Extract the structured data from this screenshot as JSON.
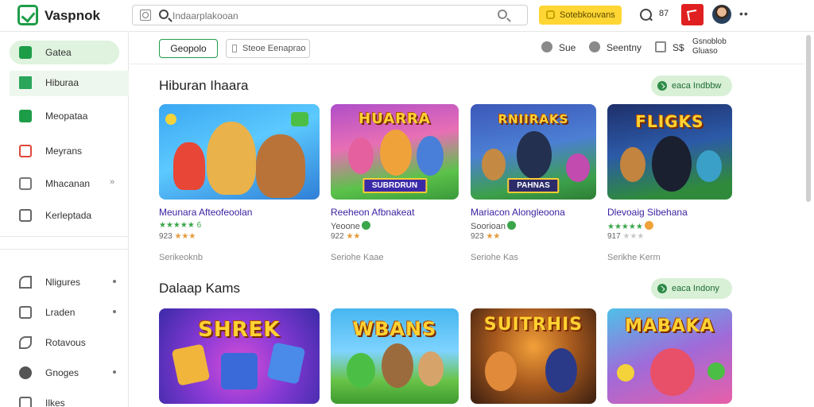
{
  "header": {
    "brand": "Vaspnok",
    "search_placeholder": "Indaarplakooan",
    "subscribe_label": "Sotebkouvans",
    "notif_count": "87",
    "more": "••"
  },
  "sidebar": {
    "items": [
      {
        "label": "Gatea",
        "icon": "game-icon"
      },
      {
        "label": "Hiburaa",
        "icon": "grid-icon"
      },
      {
        "label": "Meopataa",
        "icon": "check-icon"
      },
      {
        "label": "Meyrans",
        "icon": "calendar-icon"
      },
      {
        "label": "Mhacanan",
        "icon": "mail-icon"
      },
      {
        "label": "Kerleptada",
        "icon": "chart-icon"
      }
    ],
    "items2": [
      {
        "label": "Nligures",
        "icon": "signal-icon"
      },
      {
        "label": "Lraden",
        "icon": "window-icon"
      },
      {
        "label": "Rotavous",
        "icon": "leaf-icon"
      },
      {
        "label": "Gnoges",
        "icon": "puzzle-icon"
      },
      {
        "label": "Ilkes",
        "icon": "tag-icon"
      }
    ],
    "chevron": "»"
  },
  "subnav": {
    "chip1": "Geopolo",
    "chip2": "Steoe Eenaprao",
    "nav": [
      {
        "label": "Sue"
      },
      {
        "label": "Seentny"
      },
      {
        "label": "S$"
      }
    ],
    "lang_line1": "Gsnoblob",
    "lang_line2": "Gluaso"
  },
  "sections": [
    {
      "title": "Hiburan Ihaara",
      "see_all": "eaca Indbbw",
      "games": [
        {
          "name": "Meunara Afteofeoolan",
          "sub": "",
          "stars": "★★★★★ 6",
          "rating": "923",
          "meta": "Serikeoknb",
          "art": "",
          "banner": ""
        },
        {
          "name": "Reeheon Afbnakeat",
          "sub": "Yeoone",
          "stars": "",
          "rating": "922",
          "meta": "Seriohe Kaae",
          "art": "HUARRA",
          "banner": "SUBRDRUN"
        },
        {
          "name": "Mariacon Alongleoona",
          "sub": "Soorioan",
          "stars": "",
          "rating": "923",
          "meta": "Seriohe Kas",
          "art": "RNIIRAKS",
          "banner": "PAHNAS"
        },
        {
          "name": "Dlevoaig Sibehana",
          "sub": "★★★★★",
          "stars": "",
          "rating": "917",
          "meta": "Serikhe Kerm",
          "art": "FLIGKS",
          "banner": ""
        }
      ]
    },
    {
      "title": "Dalaap Kams",
      "see_all": "eaca Indony",
      "games": [
        {
          "name": "",
          "art": "SHREK"
        },
        {
          "name": "",
          "art": "WBANS"
        },
        {
          "name": "",
          "art": "SUITRHIS"
        },
        {
          "name": "",
          "art": "MABAKA"
        }
      ]
    }
  ],
  "colors": {
    "accent": "#1e9d49",
    "subscribe": "#ffd633",
    "flag": "#e02020",
    "game_title": "#3a1fa0"
  }
}
